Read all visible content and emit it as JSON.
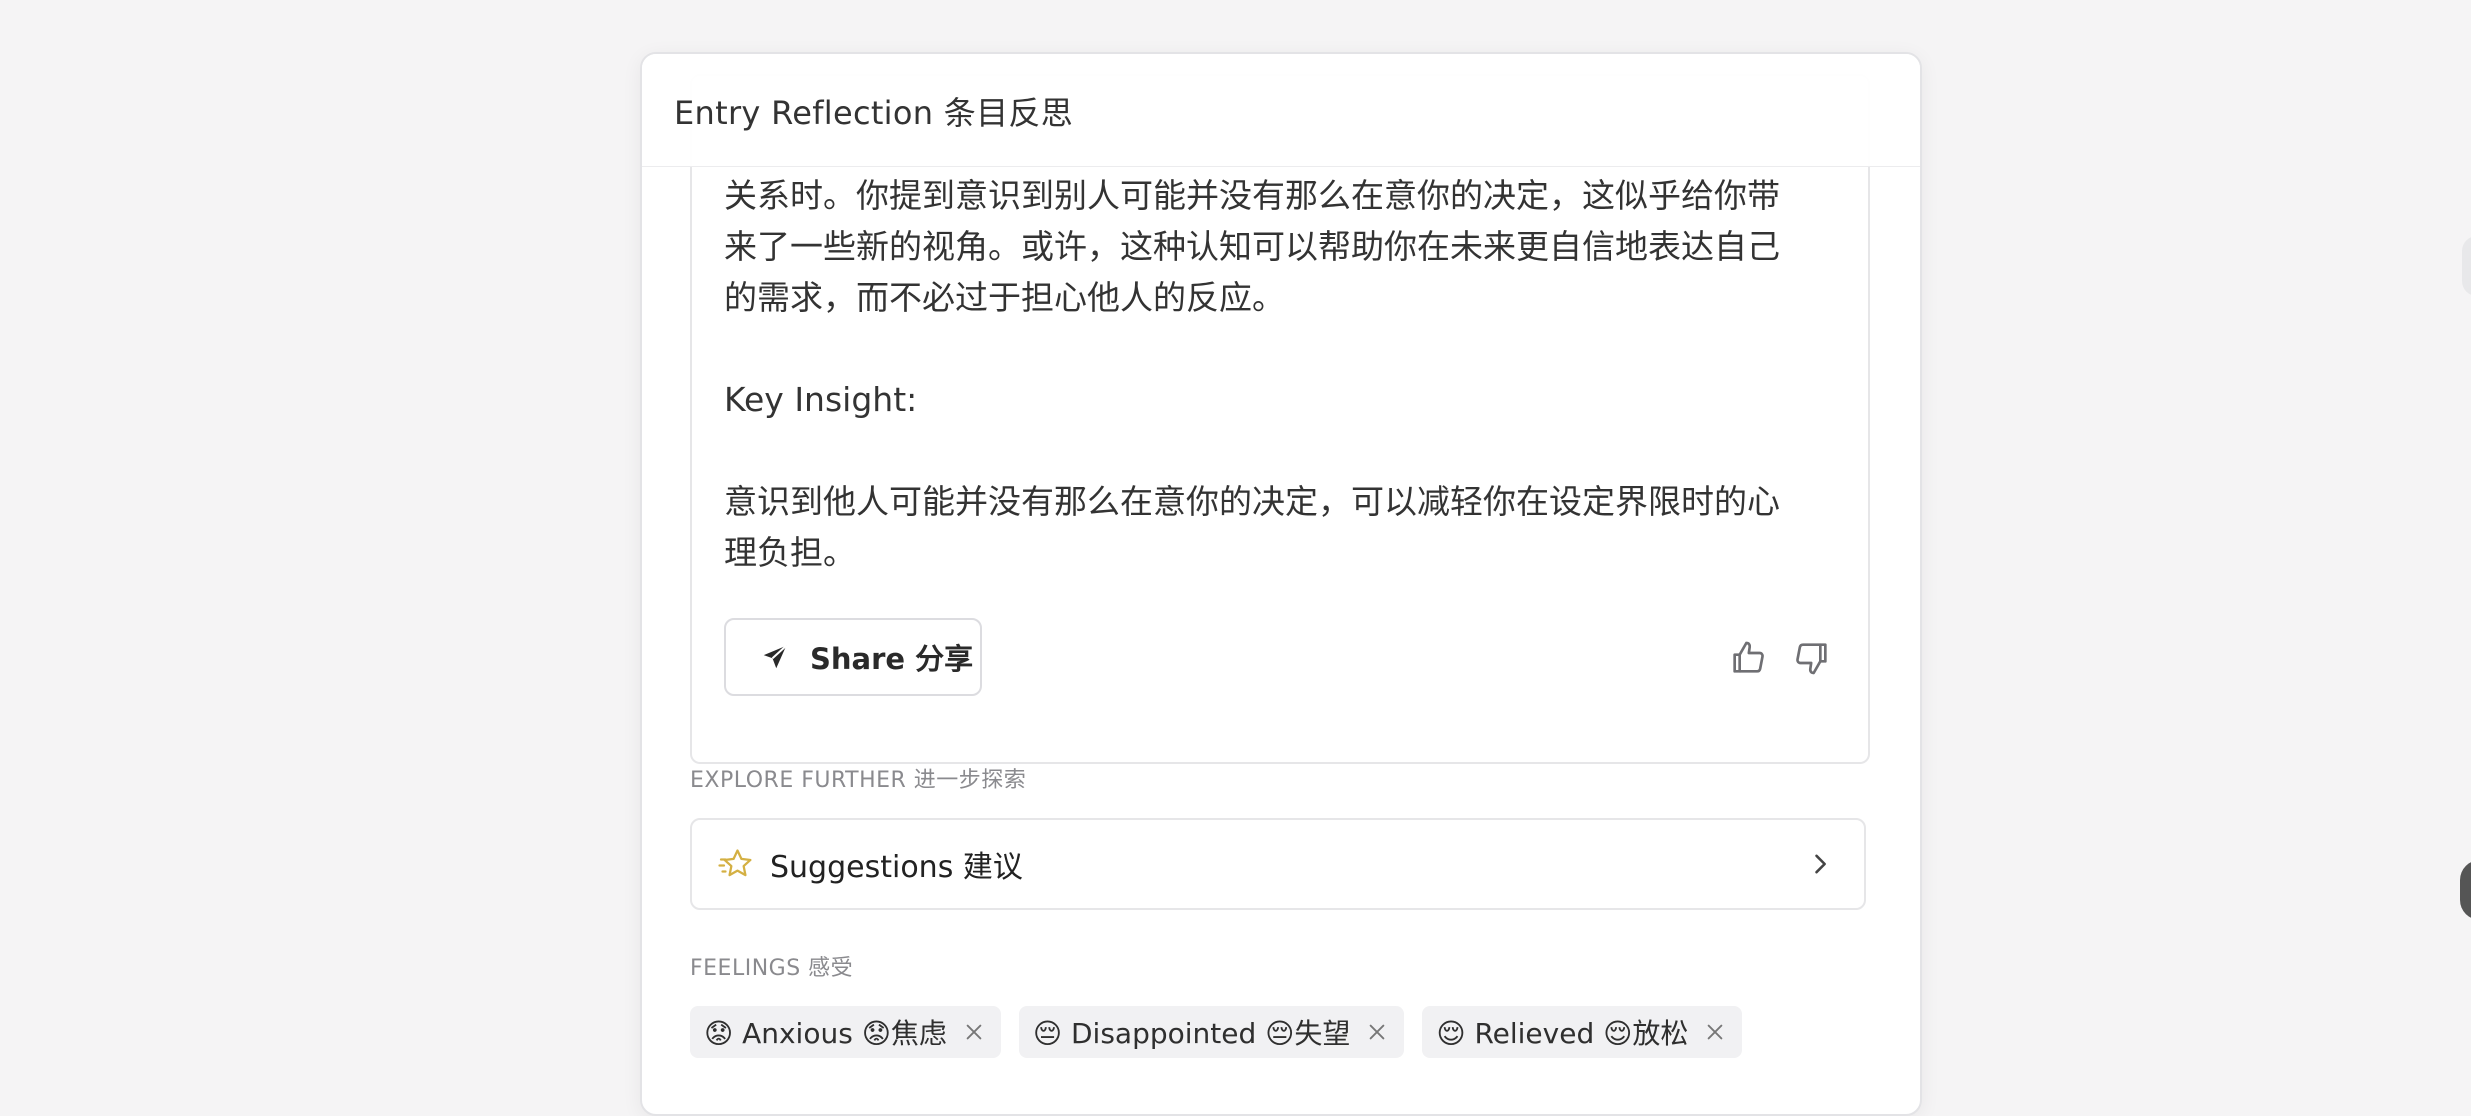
{
  "header": {
    "title": "Entry Reflection  条目反思"
  },
  "reflection": {
    "lines": [
      "关系时。你提到意识到别人可能并没有那么在意你的决定，这似乎给你带",
      "来了一些新的视角。或许，这种认知可以帮助你在未来更自信地表达自己",
      "的需求，而不必过于担心他人的反应。"
    ],
    "key_insight_heading": "Key Insight:",
    "key_insight_lines": [
      "意识到他人可能并没有那么在意你的决定，可以减轻你在设定界限时的心",
      "理负担。"
    ],
    "share_label": "Share  分享"
  },
  "explore": {
    "section_label": "EXPLORE FURTHER  进一步探索",
    "suggestions_label": "Suggestions    建议"
  },
  "feelings": {
    "section_label": "FEELINGS  感受",
    "chips": [
      {
        "label": "😟 Anxious   😟焦虑"
      },
      {
        "label": "😔 Disappointed   😔失望"
      },
      {
        "label": "😌 Relieved   😌放松"
      }
    ]
  },
  "colors": {
    "accent_star": "#d4b043",
    "background": "#f5f4f5"
  }
}
